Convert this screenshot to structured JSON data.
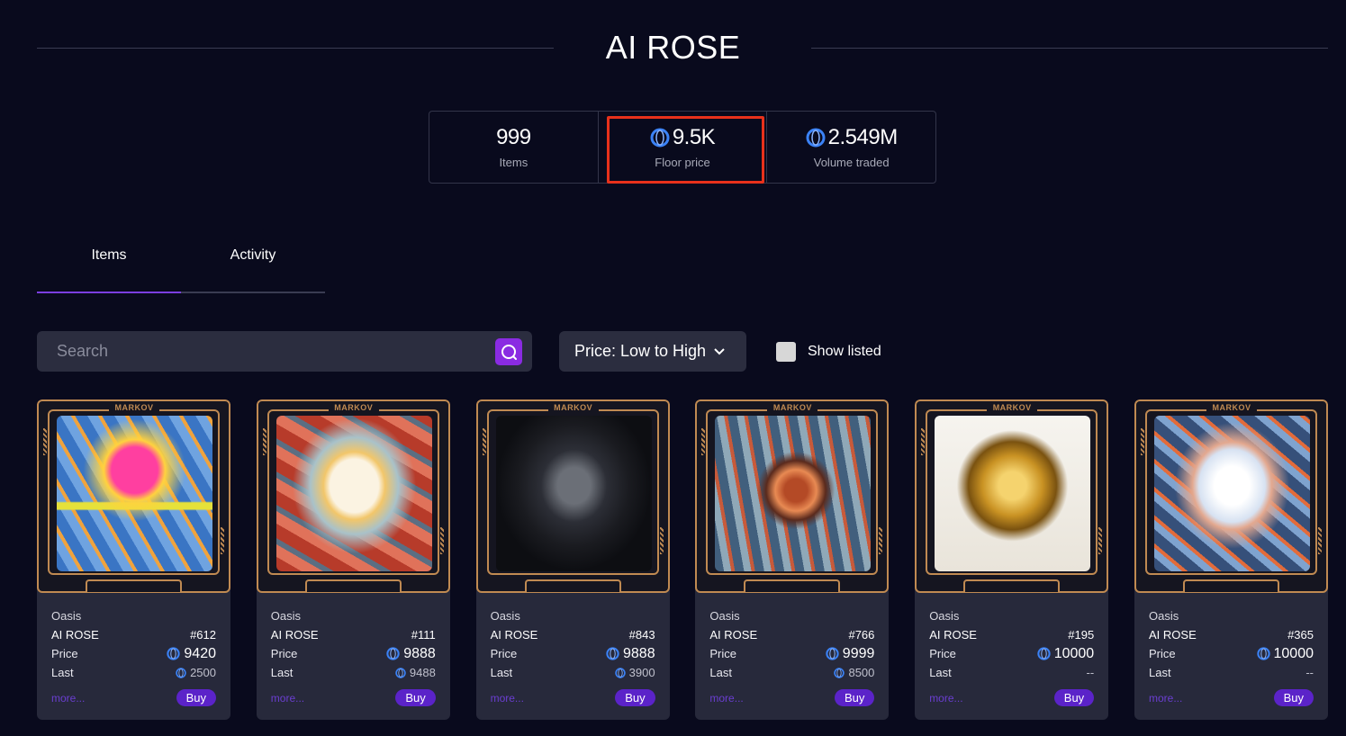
{
  "page": {
    "title": "AI ROSE"
  },
  "stats": [
    {
      "value": "999",
      "label": "Items",
      "has_icon": false
    },
    {
      "value": "9.5K",
      "label": "Floor price",
      "has_icon": true
    },
    {
      "value": "2.549M",
      "label": "Volume traded",
      "has_icon": true
    }
  ],
  "tabs": [
    {
      "label": "Items",
      "active": true
    },
    {
      "label": "Activity",
      "active": false
    }
  ],
  "search": {
    "placeholder": "Search",
    "value": ""
  },
  "sort": {
    "selected": "Price: Low to High"
  },
  "show_listed": {
    "label": "Show listed",
    "checked": false
  },
  "card_common": {
    "frame_label": "MARKOV",
    "collection": "Oasis",
    "name": "AI ROSE",
    "price_label": "Price",
    "last_label": "Last",
    "more_label": "more...",
    "buy_label": "Buy"
  },
  "cards": [
    {
      "id": "#612",
      "price": "9420",
      "last": "2500",
      "has_last_icon": true
    },
    {
      "id": "#111",
      "price": "9888",
      "last": "9488",
      "has_last_icon": true
    },
    {
      "id": "#843",
      "price": "9888",
      "last": "3900",
      "has_last_icon": true
    },
    {
      "id": "#766",
      "price": "9999",
      "last": "8500",
      "has_last_icon": true
    },
    {
      "id": "#195",
      "price": "10000",
      "last": "--",
      "has_last_icon": false
    },
    {
      "id": "#365",
      "price": "10000",
      "last": "--",
      "has_last_icon": false
    }
  ],
  "colors": {
    "background": "#090a1d",
    "accent": "#8a2be2",
    "frame_gold": "#c08a52",
    "highlight_red": "#e8311b",
    "oasis_blue": "#3b82f6"
  },
  "icons": {
    "token": "oasis-token-icon",
    "search": "search-icon",
    "dropdown": "chevron-down-icon"
  }
}
